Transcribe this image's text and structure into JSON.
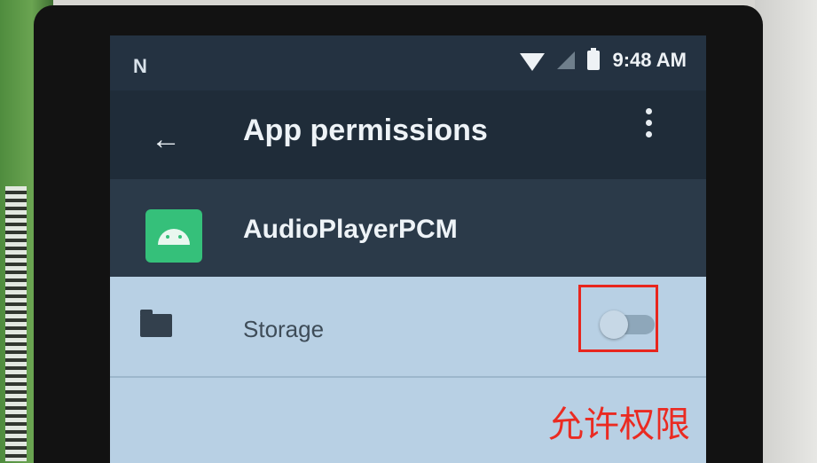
{
  "status_bar": {
    "left_glyph": "N",
    "time": "9:48 AM",
    "icons": [
      "wifi-icon",
      "signal-icon",
      "battery-icon"
    ]
  },
  "toolbar": {
    "title": "App permissions",
    "back_icon": "arrow-left-icon",
    "menu_icon": "more-vert-icon"
  },
  "app": {
    "name": "AudioPlayerPCM",
    "icon": "android-icon",
    "icon_color": "#35c07a"
  },
  "permissions": [
    {
      "label": "Storage",
      "icon": "folder-icon",
      "enabled": false
    }
  ],
  "annotation": {
    "text": "允许权限",
    "color": "#e8261e"
  }
}
